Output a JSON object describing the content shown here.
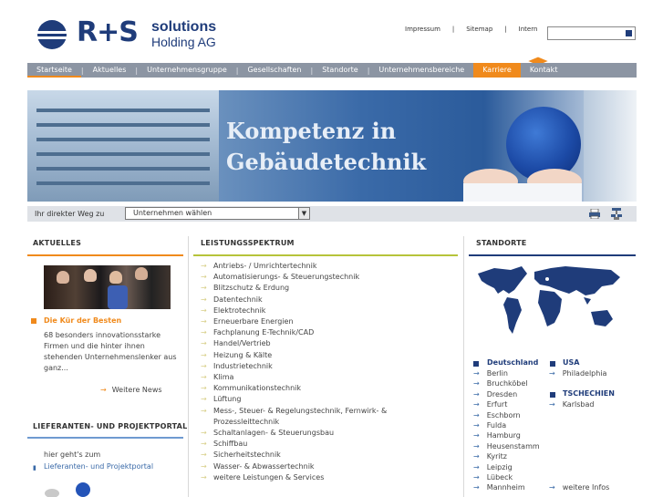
{
  "header": {
    "logo_rs": "R+S",
    "logo_line1": "solutions",
    "logo_line2": "Holding AG",
    "toplinks": [
      "Impressum",
      "Sitemap",
      "Intern"
    ],
    "search_placeholder": ""
  },
  "nav": {
    "items": [
      "Startseite",
      "Aktuelles",
      "Unternehmensgruppe",
      "Gesellschaften",
      "Standorte",
      "Unternehmensbereiche",
      "Karriere",
      "Kontakt"
    ],
    "active": "Startseite",
    "highlight": "Karriere"
  },
  "banner": {
    "line1": "Kompetenz in",
    "line2": "Gebäudetechnik"
  },
  "quickbar": {
    "label": "Ihr direkter Weg zu",
    "select_value": "Unternehmen wählen"
  },
  "aktuelles": {
    "heading": "AKTUELLES",
    "news_title": "Die Kür der Besten",
    "news_text": "68 besonders innovationsstarke Firmen und die hinter ihnen stehenden Unternehmenslenker aus ganz...",
    "more": "Weitere News"
  },
  "portal": {
    "heading": "LIEFERANTEN- UND PROJEKTPORTAL",
    "text": "hier geht's zum",
    "link": "Lieferanten- und Projektportal"
  },
  "leistung": {
    "heading": "LEISTUNGSSPEKTRUM",
    "items": [
      "Antriebs- / Umrichtertechnik",
      "Automatisierungs- & Steuerungstechnik",
      "Blitzschutz & Erdung",
      "Datentechnik",
      "Elektrotechnik",
      "Erneuerbare Energien",
      "Fachplanung E-Technik/CAD",
      "Handel/Vertrieb",
      "Heizung & Kälte",
      "Industrietechnik",
      "Klima",
      "Kommunikationstechnik",
      "Lüftung",
      "Mess-, Steuer- & Regelungstechnik, Fernwirk- & Prozessleittechnik",
      "Schaltanlagen- & Steuerungsbau",
      "Schiffbau",
      "Sicherheitstechnik",
      "Wasser- & Abwassertechnik",
      "weitere Leistungen & Services"
    ]
  },
  "standorte": {
    "heading": "STANDORTE",
    "deutschland": "Deutschland",
    "de_cities": [
      "Berlin",
      "Bruchköbel",
      "Dresden",
      "Erfurt",
      "Eschborn",
      "Fulda",
      "Hamburg",
      "Heusenstamm",
      "Kyritz",
      "Leipzig",
      "Lübeck",
      "Mannheim"
    ],
    "usa": "USA",
    "usa_cities": [
      "Philadelphia"
    ],
    "cz": "TSCHECHIEN",
    "cz_cities": [
      "Karlsbad"
    ],
    "more": "weitere Infos"
  },
  "colors": {
    "brand_blue": "#1f3c7a",
    "accent_orange": "#f08a1c",
    "nav_gray": "#8c95a3",
    "leist_line": "#b6c43a",
    "portal_line": "#6e9ad0"
  }
}
